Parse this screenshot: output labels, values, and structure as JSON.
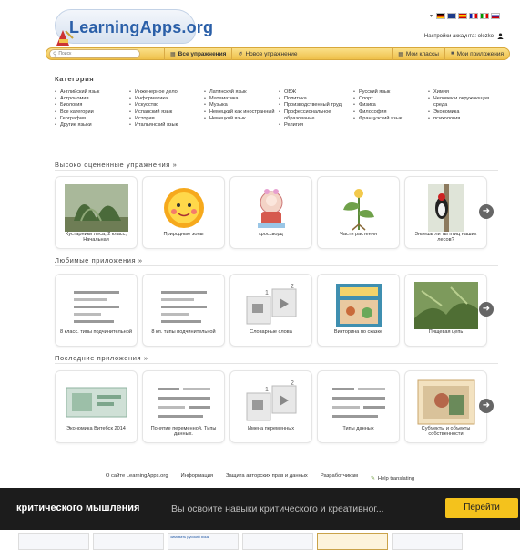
{
  "header": {
    "logo_text": "LearningApps.org",
    "account_label": "Настройки аккаунта: olezko"
  },
  "nav": {
    "search_placeholder": "Поиск",
    "all_exercises": "Все упражнения",
    "new_exercise": "Новое упражнение",
    "my_classes": "Мои классы",
    "my_apps": "Мои приложения"
  },
  "category": {
    "title": "Категория",
    "columns": [
      [
        "Английский язык",
        "Астрономия",
        "Биология",
        "Все категории",
        "География",
        "Другие языки"
      ],
      [
        "Инженерное дело",
        "Информатика",
        "Искусство",
        "Испанский язык",
        "История",
        "Итальянский язык"
      ],
      [
        "Латинский язык",
        "Математика",
        "Музыка",
        "Немецкий как иностранный",
        "Немецкий язык"
      ],
      [
        "ОБЖ",
        "Политика",
        "Производственный труд",
        "Профессиональное образование",
        "Религия"
      ],
      [
        "Русский язык",
        "Спорт",
        "Физика",
        "Философия",
        "Французский язык"
      ],
      [
        "Химия",
        "Человек и окружающая среда",
        "Экономика",
        "психология"
      ]
    ]
  },
  "sections": {
    "top_rated": "Высоко оцененные упражнения »",
    "favorites": "Любимые приложения »",
    "recent": "Последние приложения »"
  },
  "top_rated_cards": [
    "Кустарники леса, 2 класс, Начальная",
    "Природные зоны",
    "кроссворд",
    "Части растения",
    "Знаешь ли ты птиц наших лесов?"
  ],
  "favorite_cards": [
    "8 класс. типы подчинительной",
    "8 кл. типы подчинительной",
    "Словарные слова",
    "Викторина по сказке",
    "Пищевая цепь"
  ],
  "recent_cards": [
    "Экономика Витебск 2014",
    "Понятие переменной. Типы данных.",
    "Имена переменных",
    "Типы данных",
    "Субъекты и объекты собственности"
  ],
  "footer": {
    "links": [
      "О сайте LearningApps.org",
      "Информация",
      "Защита авторских прав и данных",
      "Разработчикам",
      "Help translating"
    ]
  },
  "banner": {
    "title": "критического мышления",
    "description": "Вы освоите навыки критического и креативног...",
    "button": "Перейти"
  },
  "strip": {
    "thumb_texts": [
      "",
      "",
      "зимовать русский язык",
      "",
      "",
      "",
      "",
      ""
    ]
  },
  "colors": {
    "nav_yellow": "#efc04a",
    "logo_blue": "#2a5fa8",
    "banner_bg": "#1c1c1c",
    "banner_button": "#f4c21c"
  }
}
